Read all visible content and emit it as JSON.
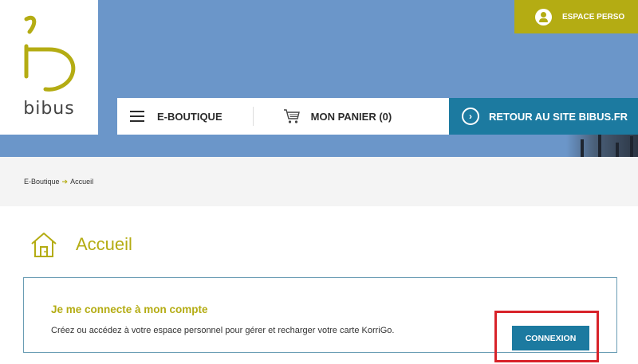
{
  "logo": {
    "brand": "bibus"
  },
  "header": {
    "espace_perso": "ESPACE PERSO",
    "nav": {
      "eboutique": "E-BOUTIQUE",
      "panier": "MON PANIER (0)"
    },
    "retour": "RETOUR AU SITE BIBUS.FR"
  },
  "breadcrumb": {
    "items": [
      "E-Boutique",
      "Accueil"
    ],
    "separator": "➔"
  },
  "page": {
    "title": "Accueil"
  },
  "card": {
    "title": "Je me connecte à mon compte",
    "description": "Créez ou accédez à votre espace personnel pour gérer et recharger votre carte KorriGo.",
    "button": "CONNEXION"
  },
  "colors": {
    "accent": "#b4ac13",
    "primary": "#1c7aa0",
    "hero": "#6b96c9",
    "highlight": "#d8232a"
  },
  "icons": [
    "user-icon",
    "menu-icon",
    "cart-icon",
    "chevron-right-icon",
    "home-icon"
  ]
}
